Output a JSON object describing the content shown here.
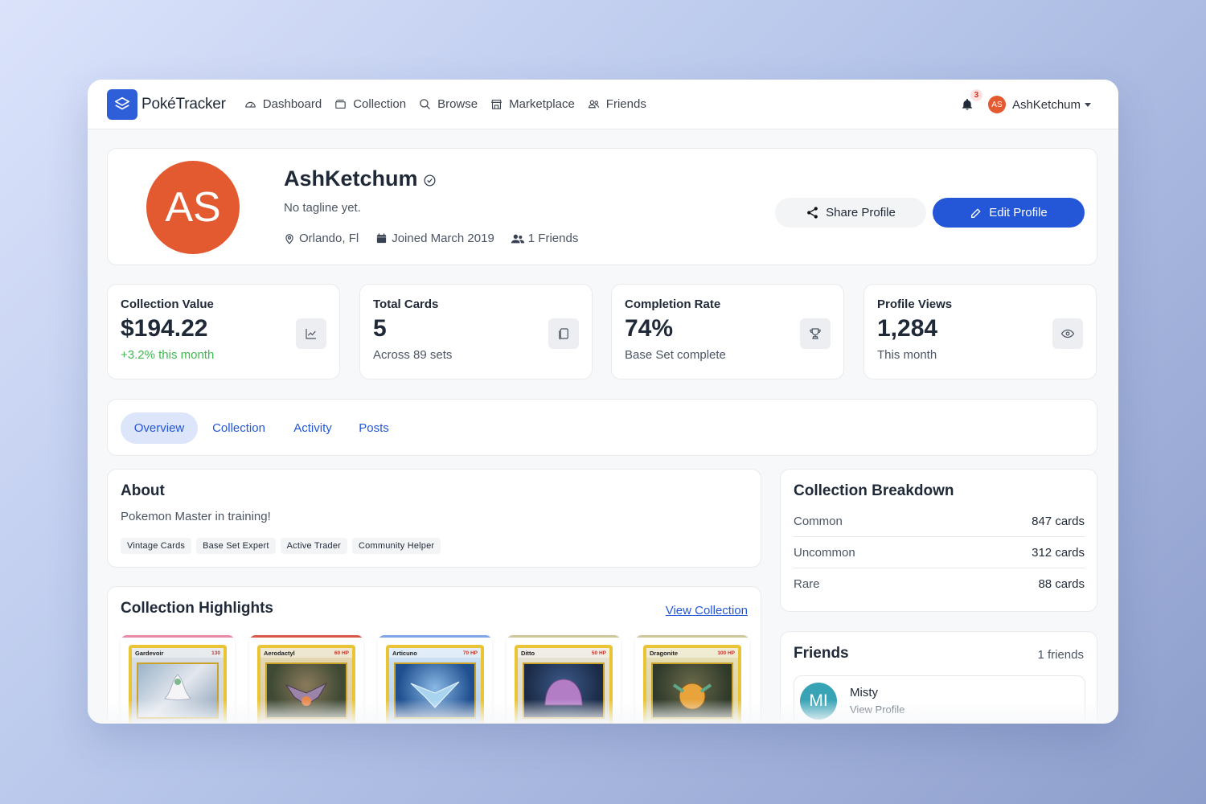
{
  "nav": {
    "brand": "PokéTracker",
    "items": [
      {
        "label": "Dashboard",
        "icon": "gauge-icon"
      },
      {
        "label": "Collection",
        "icon": "box-icon"
      },
      {
        "label": "Browse",
        "icon": "search-icon"
      },
      {
        "label": "Marketplace",
        "icon": "store-icon"
      },
      {
        "label": "Friends",
        "icon": "people-icon"
      }
    ],
    "notifications_count": "3",
    "user_initials": "AS",
    "username": "AshKetchum"
  },
  "profile": {
    "initials": "AS",
    "name": "AshKetchum",
    "tagline": "No tagline yet.",
    "location": "Orlando, Fl",
    "joined": "Joined March 2019",
    "friends": "1 Friends",
    "share_label": "Share Profile",
    "edit_label": "Edit Profile"
  },
  "stats": [
    {
      "label": "Collection Value",
      "value": "$194.22",
      "sub": "+3.2% this month",
      "icon": "chart-line-icon"
    },
    {
      "label": "Total Cards",
      "value": "5",
      "sub": "Across 89 sets",
      "icon": "cards-icon"
    },
    {
      "label": "Completion Rate",
      "value": "74%",
      "sub": "Base Set complete",
      "icon": "trophy-icon"
    },
    {
      "label": "Profile Views",
      "value": "1,284",
      "sub": "This month",
      "icon": "eye-icon"
    }
  ],
  "tabs": [
    "Overview",
    "Collection",
    "Activity",
    "Posts"
  ],
  "active_tab": "Overview",
  "about": {
    "title": "About",
    "text": "Pokemon Master in training!",
    "badges": [
      "Vintage Cards",
      "Base Set Expert",
      "Active Trader",
      "Community Helper"
    ]
  },
  "highlights": {
    "title": "Collection Highlights",
    "link": "View Collection",
    "cards": [
      {
        "name": "Gardevoir",
        "hp": "130",
        "accent": "#e889a6"
      },
      {
        "name": "Aerodactyl",
        "hp": "60 HP",
        "accent": "#d9574a"
      },
      {
        "name": "Articuno",
        "hp": "70 HP",
        "accent": "#7fa6e6"
      },
      {
        "name": "Ditto",
        "hp": "50 HP",
        "accent": "#cfc79a"
      },
      {
        "name": "Dragonite",
        "hp": "100 HP",
        "accent": "#cfc79a"
      }
    ]
  },
  "breakdown": {
    "title": "Collection Breakdown",
    "rows": [
      {
        "label": "Common",
        "value": "847 cards"
      },
      {
        "label": "Uncommon",
        "value": "312 cards"
      },
      {
        "label": "Rare",
        "value": "88 cards"
      }
    ]
  },
  "friends_panel": {
    "title": "Friends",
    "count": "1 friends",
    "list": [
      {
        "initials": "MI",
        "name": "Misty",
        "action": "View Profile"
      }
    ]
  },
  "colors": {
    "primary": "#2357d8",
    "avatar": "#e35a31",
    "friend_avatar": "#37a3b5",
    "positive": "#3fb950"
  }
}
